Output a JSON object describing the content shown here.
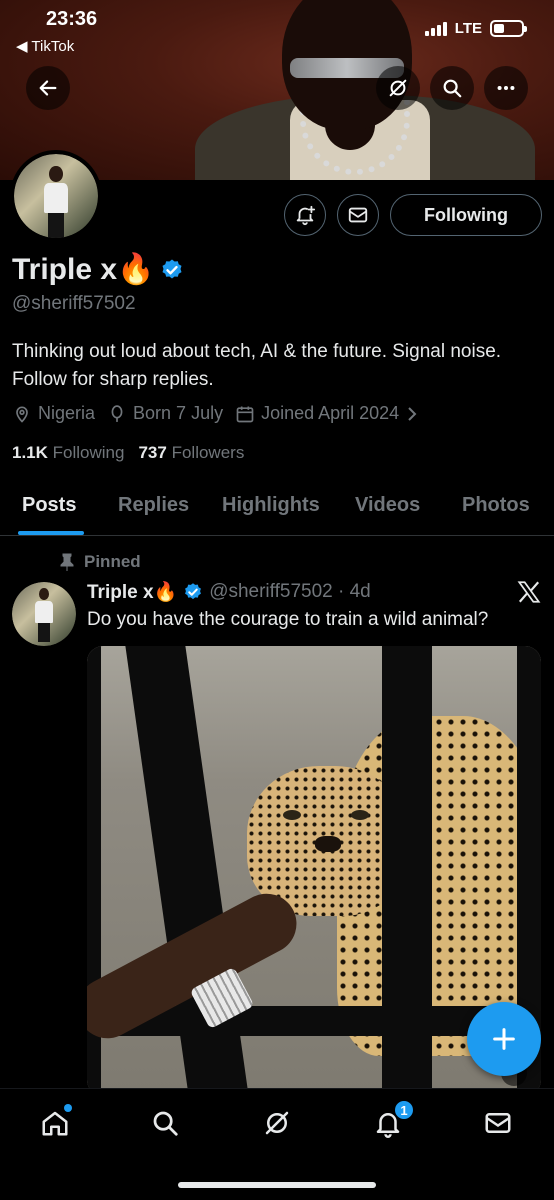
{
  "status_bar": {
    "time": "23:36",
    "back_app": "◀ TikTok",
    "network": "LTE"
  },
  "profile": {
    "name": "Triple x🔥",
    "handle": "@sheriff57502",
    "bio": "Thinking out loud about tech, AI & the future. Signal noise. Follow for sharp replies.",
    "location": "Nigeria",
    "born": "Born 7 July",
    "joined": "Joined April 2024",
    "following_count": "1.1K",
    "following_label": "Following",
    "followers_count": "737",
    "followers_label": "Followers",
    "follow_button_label": "Following"
  },
  "tabs": [
    "Posts",
    "Replies",
    "Highlights",
    "Videos",
    "Photos"
  ],
  "active_tab": "Posts",
  "post": {
    "pinned_label": "Pinned",
    "author_name": "Triple x🔥",
    "author_handle_time": "@sheriff57502 · 4d",
    "text": "Do you have the courage to train a wild animal?"
  },
  "bottom_nav": {
    "items": [
      "home-icon",
      "search-icon",
      "grok-icon",
      "notifications-icon",
      "messages-icon"
    ],
    "notification_badge": "1"
  },
  "colors": {
    "accent": "#1d9bf0",
    "background": "#000000",
    "secondary_text": "#71767b"
  }
}
